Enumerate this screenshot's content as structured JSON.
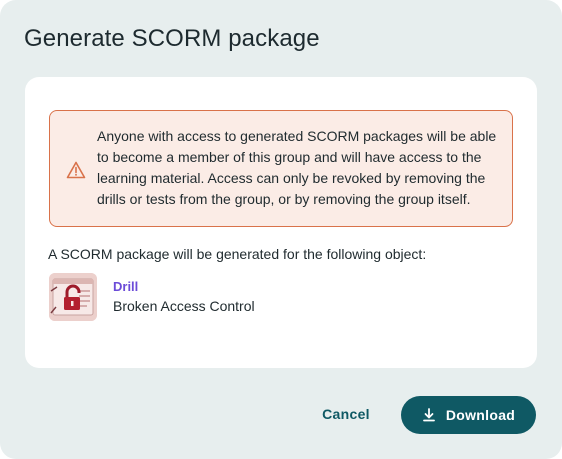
{
  "dialog": {
    "title": "Generate SCORM package"
  },
  "warning": {
    "icon": "warning-triangle-icon",
    "text": "Anyone with access to generated SCORM packages will be able to become a member of this group and will have access to the learning material. Access can only be revoked by removing the drills or tests from the group, or by removing the group itself.",
    "color": "#d9724a"
  },
  "object": {
    "intro": "A SCORM package will be generated for the following object:",
    "type": "Drill",
    "name": "Broken Access Control",
    "thumbnail_icon": "padlock-icon"
  },
  "actions": {
    "cancel_label": "Cancel",
    "download_label": "Download",
    "download_icon": "download-icon",
    "accent": "#0f5964"
  }
}
